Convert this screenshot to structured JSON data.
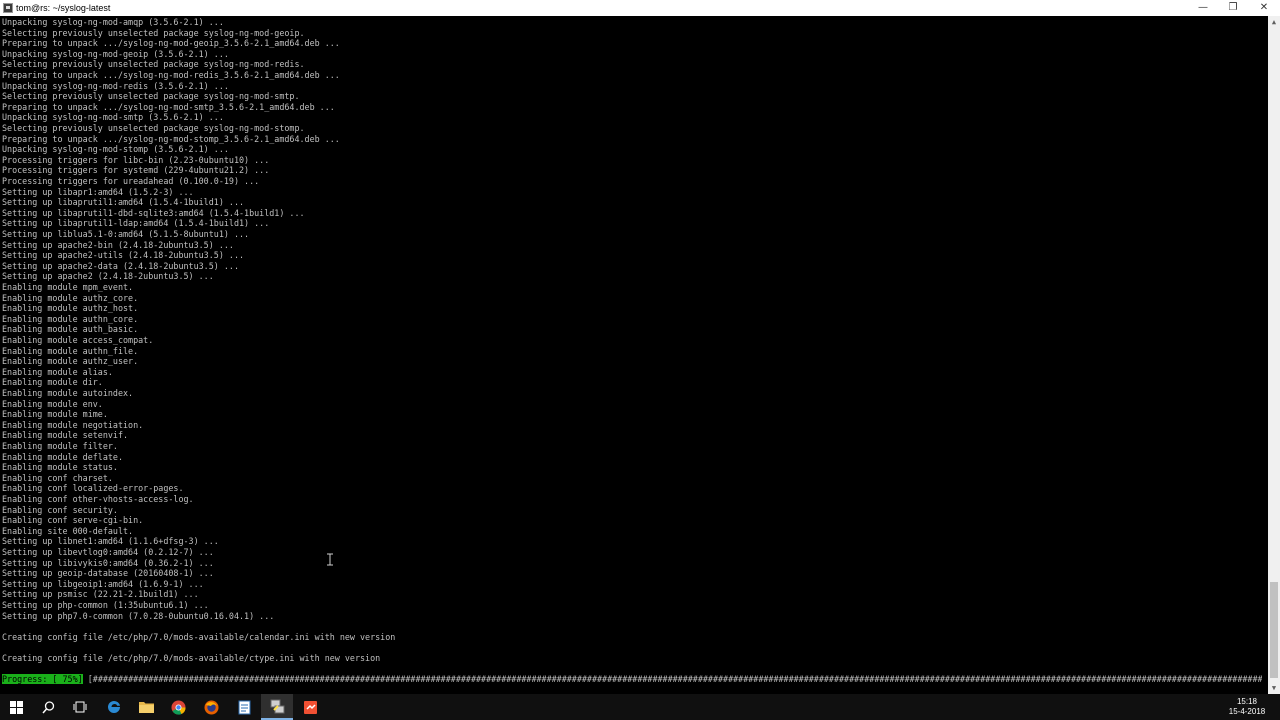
{
  "window": {
    "title": "tom@rs: ~/syslog-latest",
    "minimize": "—",
    "maximize": "❐",
    "close": "✕"
  },
  "terminal": {
    "lines": [
      "Unpacking syslog-ng-mod-amqp (3.5.6-2.1) ...",
      "Selecting previously unselected package syslog-ng-mod-geoip.",
      "Preparing to unpack .../syslog-ng-mod-geoip_3.5.6-2.1_amd64.deb ...",
      "Unpacking syslog-ng-mod-geoip (3.5.6-2.1) ...",
      "Selecting previously unselected package syslog-ng-mod-redis.",
      "Preparing to unpack .../syslog-ng-mod-redis_3.5.6-2.1_amd64.deb ...",
      "Unpacking syslog-ng-mod-redis (3.5.6-2.1) ...",
      "Selecting previously unselected package syslog-ng-mod-smtp.",
      "Preparing to unpack .../syslog-ng-mod-smtp_3.5.6-2.1_amd64.deb ...",
      "Unpacking syslog-ng-mod-smtp (3.5.6-2.1) ...",
      "Selecting previously unselected package syslog-ng-mod-stomp.",
      "Preparing to unpack .../syslog-ng-mod-stomp_3.5.6-2.1_amd64.deb ...",
      "Unpacking syslog-ng-mod-stomp (3.5.6-2.1) ...",
      "Processing triggers for libc-bin (2.23-0ubuntu10) ...",
      "Processing triggers for systemd (229-4ubuntu21.2) ...",
      "Processing triggers for ureadahead (0.100.0-19) ...",
      "Setting up libapr1:amd64 (1.5.2-3) ...",
      "Setting up libaprutil1:amd64 (1.5.4-1build1) ...",
      "Setting up libaprutil1-dbd-sqlite3:amd64 (1.5.4-1build1) ...",
      "Setting up libaprutil1-ldap:amd64 (1.5.4-1build1) ...",
      "Setting up liblua5.1-0:amd64 (5.1.5-8ubuntu1) ...",
      "Setting up apache2-bin (2.4.18-2ubuntu3.5) ...",
      "Setting up apache2-utils (2.4.18-2ubuntu3.5) ...",
      "Setting up apache2-data (2.4.18-2ubuntu3.5) ...",
      "Setting up apache2 (2.4.18-2ubuntu3.5) ...",
      "Enabling module mpm_event.",
      "Enabling module authz_core.",
      "Enabling module authz_host.",
      "Enabling module authn_core.",
      "Enabling module auth_basic.",
      "Enabling module access_compat.",
      "Enabling module authn_file.",
      "Enabling module authz_user.",
      "Enabling module alias.",
      "Enabling module dir.",
      "Enabling module autoindex.",
      "Enabling module env.",
      "Enabling module mime.",
      "Enabling module negotiation.",
      "Enabling module setenvif.",
      "Enabling module filter.",
      "Enabling module deflate.",
      "Enabling module status.",
      "Enabling conf charset.",
      "Enabling conf localized-error-pages.",
      "Enabling conf other-vhosts-access-log.",
      "Enabling conf security.",
      "Enabling conf serve-cgi-bin.",
      "Enabling site 000-default.",
      "Setting up libnet1:amd64 (1.1.6+dfsg-3) ...",
      "Setting up libevtlog0:amd64 (0.2.12-7) ...",
      "Setting up libivykis0:amd64 (0.36.2-1) ...",
      "Setting up geoip-database (20160408-1) ...",
      "Setting up libgeoip1:amd64 (1.6.9-1) ...",
      "Setting up psmisc (22.21-2.1build1) ...",
      "Setting up php-common (1:35ubuntu6.1) ...",
      "Setting up php7.0-common (7.0.28-0ubuntu0.16.04.1) ...",
      "",
      "Creating config file /etc/php/7.0/mods-available/calendar.ini with new version",
      "",
      "Creating config file /etc/php/7.0/mods-available/ctype.ini with new version"
    ],
    "progress": {
      "label": "Progress: [ 75%]",
      "percent": 75,
      "bar": "[###############################################################################################################################################################################################################################################################################.......................................................................................]"
    }
  },
  "taskbar": {
    "items": [
      {
        "name": "start-button",
        "icon": "windows-icon"
      },
      {
        "name": "search-button",
        "icon": "search-icon"
      },
      {
        "name": "task-view-button",
        "icon": "task-view-icon"
      },
      {
        "name": "edge-app",
        "icon": "edge-icon"
      },
      {
        "name": "file-explorer-app",
        "icon": "folder-icon"
      },
      {
        "name": "chrome-app",
        "icon": "chrome-icon"
      },
      {
        "name": "firefox-app",
        "icon": "firefox-icon"
      },
      {
        "name": "notepad-app",
        "icon": "notepad-icon"
      },
      {
        "name": "putty-app",
        "icon": "putty-icon"
      },
      {
        "name": "git-app",
        "icon": "git-icon"
      }
    ],
    "clock": {
      "time": "15:18",
      "date": "15-4-2018"
    }
  },
  "colors": {
    "terminal_text": "#c0c0c0",
    "terminal_bg": "#000000",
    "progress_green": "#1ab01a",
    "taskbar_bg": "#101010"
  }
}
